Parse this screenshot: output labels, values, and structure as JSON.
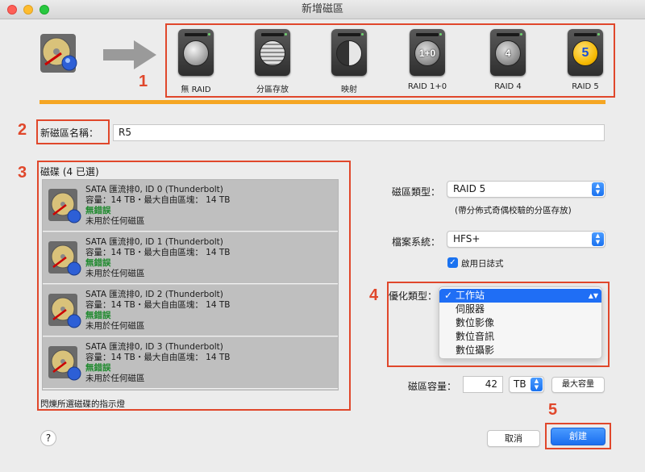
{
  "window": {
    "title": "新增磁區"
  },
  "raid_types": [
    {
      "label": "無 RAID",
      "icon": "raid-none-icon",
      "badge": ""
    },
    {
      "label": "分區存放",
      "icon": "raid-stripe-icon",
      "badge": ""
    },
    {
      "label": "映射",
      "icon": "raid-mirror-icon",
      "badge": ""
    },
    {
      "label": "RAID 1+0",
      "icon": "raid-10-icon",
      "badge": "1+0"
    },
    {
      "label": "RAID 4",
      "icon": "raid-4-icon",
      "badge": "4"
    },
    {
      "label": "RAID 5",
      "icon": "raid-5-icon",
      "badge": "5"
    }
  ],
  "callouts": {
    "c1": "1",
    "c2": "2",
    "c3": "3",
    "c4": "4",
    "c5": "5"
  },
  "name_field": {
    "label": "新磁區名稱：",
    "value": "R5"
  },
  "disks": {
    "title": "磁碟 (4 已選)",
    "items": [
      {
        "name": "SATA 匯流排0, ID 0 (Thunderbolt)",
        "capacity": "容量：14 TB・最大自由區塊： 14 TB",
        "status": "無錯誤",
        "usage": "未用於任何磁區"
      },
      {
        "name": "SATA 匯流排0, ID 1 (Thunderbolt)",
        "capacity": "容量：14 TB・最大自由區塊： 14 TB",
        "status": "無錯誤",
        "usage": "未用於任何磁區"
      },
      {
        "name": "SATA 匯流排0, ID 2 (Thunderbolt)",
        "capacity": "容量：14 TB・最大自由區塊： 14 TB",
        "status": "無錯誤",
        "usage": "未用於任何磁區"
      },
      {
        "name": "SATA 匯流排0, ID 3 (Thunderbolt)",
        "capacity": "容量：14 TB・最大自由區塊： 14 TB",
        "status": "無錯誤",
        "usage": "未用於任何磁區"
      }
    ],
    "blink_label": "閃爍所選磁碟的指示燈"
  },
  "volume_type": {
    "label": "磁區類型：",
    "value": "RAID 5",
    "hint": "(帶分佈式奇偶校驗的分區存放)"
  },
  "filesystem": {
    "label": "檔案系統：",
    "value": "HFS+",
    "journal_label": "啟用日誌式",
    "journal_checked": true
  },
  "optimize": {
    "label": "優化類型：",
    "options": [
      "工作站",
      "伺服器",
      "數位影像",
      "數位音訊",
      "數位攝影"
    ],
    "selected": "工作站"
  },
  "capacity": {
    "label": "磁區容量：",
    "value": "42",
    "unit": "TB",
    "max_button": "最大容量"
  },
  "buttons": {
    "cancel": "取消",
    "create": "創建",
    "help": "?"
  },
  "colors": {
    "accent": "#1f6ef5",
    "callout": "#e0472b",
    "bar": "#f5a623",
    "ok": "#1f8a2e"
  }
}
